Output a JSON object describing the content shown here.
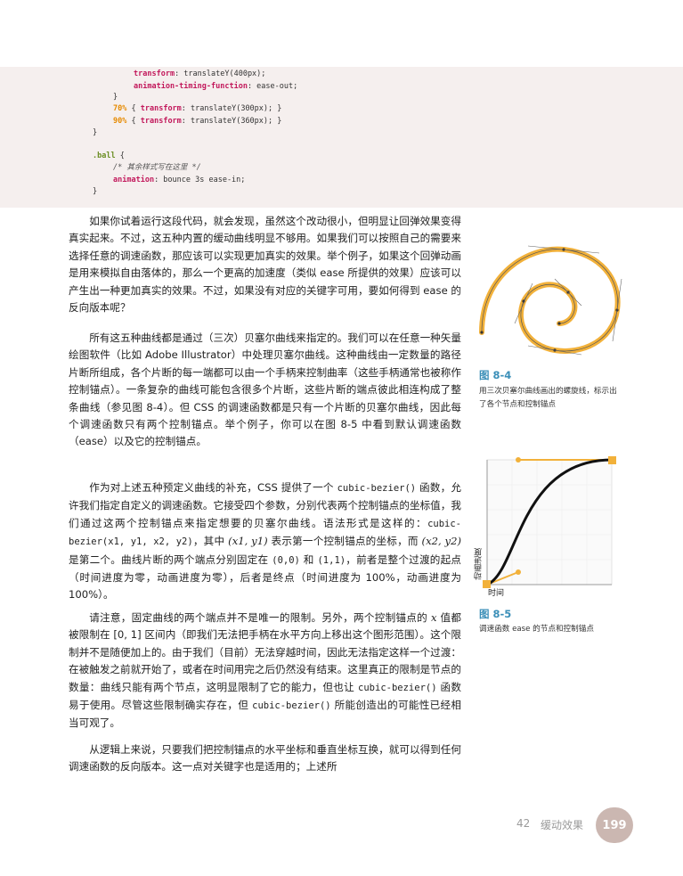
{
  "code": {
    "line1_prop": "transform",
    "line1_val": ": translateY(400px);",
    "line2_prop": "animation-timing-function",
    "line2_val": ": ease-out;",
    "line3": "}",
    "line4_pct": "70%",
    "line4_rest": "{ ",
    "line4_prop": "transform",
    "line4_val": ": translateY(300px); }",
    "line5_pct": "90%",
    "line5_rest": "{ ",
    "line5_prop": "transform",
    "line5_val": ": translateY(360px); }",
    "line6": "}",
    "line7_sel": ".ball",
    "line7_rest": " {",
    "line8_comment": "/* 其余样式写在这里 */",
    "line9_prop": "animation",
    "line9_val": ": bounce 3s ease-in;",
    "line10": "}"
  },
  "paragraphs": {
    "p1": "如果你试着运行这段代码，就会发现，虽然这个改动很小，但明显让回弹效果变得真实起来。不过，这五种内置的缓动曲线明显不够用。如果我们可以按照自己的需要来选择任意的调速函数，那应该可以实现更加真实的效果。举个例子，如果这个回弹动画是用来模拟自由落体的，那么一个更高的加速度（类似 ease 所提供的效果）应该可以产生出一种更加真实的效果。不过，如果没有对应的关键字可用，要如何得到 ease 的反向版本呢？",
    "p2": "所有这五种曲线都是通过（三次）贝塞尔曲线来指定的。我们可以在任意一种矢量绘图软件（比如 Adobe Illustrator）中处理贝塞尔曲线。这种曲线由一定数量的路径片断所组成，各个片断的每一端都可以由一个手柄来控制曲率（这些手柄通常也被称作控制锚点）。一条复杂的曲线可能包含很多个片断，这些片断的端点彼此相连构成了整条曲线（参见图 8-4）。但 CSS 的调速函数都是只有一个片断的贝塞尔曲线，因此每个调速函数只有两个控制锚点。举个例子，你可以在图 8-5 中看到默认调速函数（ease）以及它的控制锚点。",
    "p3_a": "作为对上述五种预定义曲线的补充，CSS 提供了一个 ",
    "p3_code1": "cubic-bezier()",
    "p3_b": " 函数，允许我们指定自定义的调速函数。它接受四个参数，分别代表两个控制锚点的坐标值，我们通过这两个控制锚点来指定想要的贝塞尔曲线。语法形式是这样的：",
    "p3_code2": "cubic-bezier(x1, y1, x2, y2)",
    "p3_c": "，其中 ",
    "p3_xy1": "(x1, y1)",
    "p3_d": " 表示第一个控制锚点的坐标，而 ",
    "p3_xy2": "(x2, y2)",
    "p3_e": " 是第二个。曲线片断的两个端点分别固定在 ",
    "p3_code3": "(0,0)",
    "p3_f": " 和 ",
    "p3_code4": "(1,1)",
    "p3_g": "，前者是整个过渡的起点（时间进度为零，动画进度为零），后者是终点（时间进度为 100%，动画进度为 100%）。",
    "p4_a": "请注意，固定曲线的两个端点并不是唯一的限制。另外，两个控制锚点的 ",
    "p4_x": "x",
    "p4_b": " 值都被限制在 [0, 1] 区间内（即我们无法把手柄在水平方向上移出这个图形范围）。这个限制并不是随便加上的。由于我们（目前）无法穿越时间，因此无法指定这样一个过渡：在被触发之前就开始了，或者在时间用完之后仍然没有结束。这里真正的限制是节点的数量：曲线只能有两个节点，这明显限制了它的能力，但也让 ",
    "p4_code1": "cubic-bezier()",
    "p4_c": " 函数易于使用。尽管这些限制确实存在，但 ",
    "p4_code2": "cubic-bezier()",
    "p4_d": " 所能创造出的可能性已经相当可观了。",
    "p5": "从逻辑上来说，只要我们把控制锚点的水平坐标和垂直坐标互换，就可以得到任何调速函数的反向版本。这一点对关键字也是适用的；上述所"
  },
  "figures": {
    "fig4_label": "图 8-4",
    "fig4_caption": "用三次贝塞尔曲线画出的螺旋线，标示出了各个节点和控制锚点",
    "fig5_label": "图 8-5",
    "fig5_caption": "调速函数 ease 的节点和控制锚点",
    "fig5_ylabel": "动画进度",
    "fig5_xlabel": "时间"
  },
  "footer": {
    "chapter_number": "42",
    "chapter_title": "缓动效果",
    "page_number": "199"
  },
  "colors": {
    "curve_accent": "#f2b13a",
    "figure_label": "#3b8fb8",
    "code_background": "#f5efee"
  }
}
